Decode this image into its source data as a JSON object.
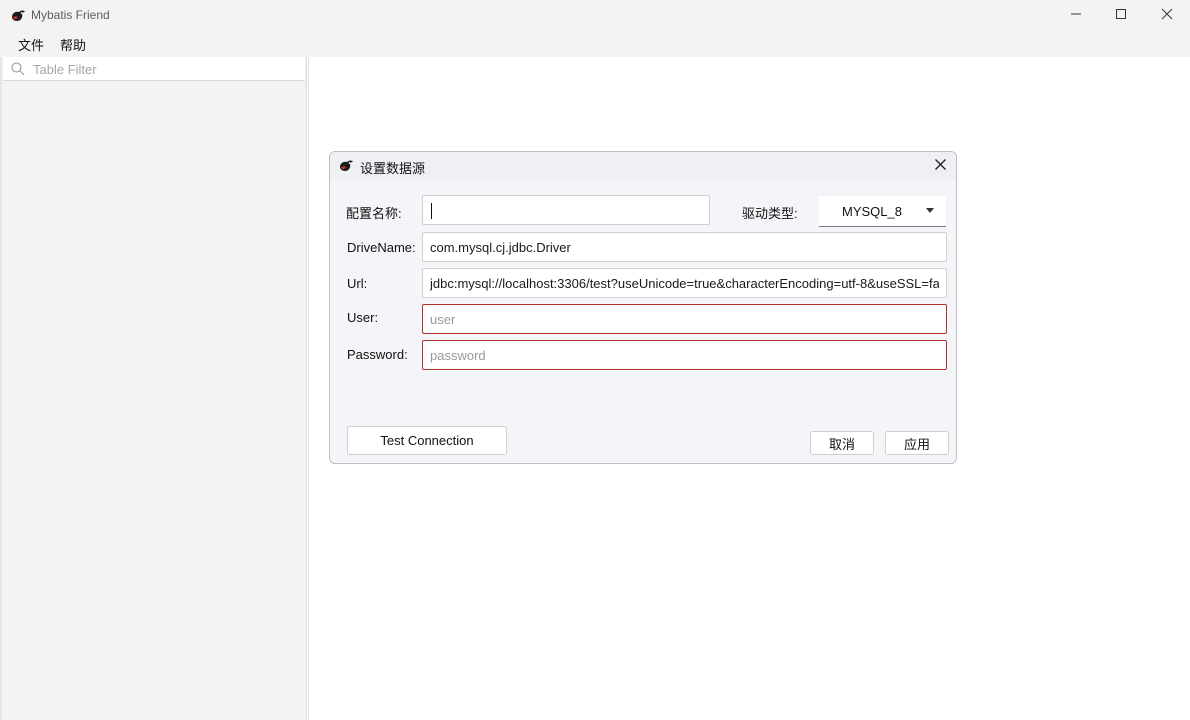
{
  "window": {
    "title": "Mybatis Friend"
  },
  "menu": {
    "items": [
      {
        "label": "文件"
      },
      {
        "label": "帮助"
      }
    ]
  },
  "sidebar": {
    "filter_placeholder": "Table Filter"
  },
  "dialog": {
    "title": "设置数据源",
    "config_name_label": "配置名称:",
    "config_name_value": "",
    "driver_type_label": "驱动类型:",
    "driver_type_value": "MYSQL_8",
    "drive_name_label": "DriveName:",
    "drive_name_value": "com.mysql.cj.jdbc.Driver",
    "url_label": "Url:",
    "url_value": "jdbc:mysql://localhost:3306/test?useUnicode=true&characterEncoding=utf-8&useSSL=fa",
    "user_label": "User:",
    "user_placeholder": "user",
    "password_label": "Password:",
    "password_placeholder": "password",
    "test_connection_label": "Test Connection",
    "cancel_label": "取消",
    "apply_label": "应用"
  },
  "colors": {
    "chrome_bg": "#f3f3f3",
    "dialog_bg": "#f4f5f8",
    "error_border": "#b52f2f",
    "accent": "#1a1a1a"
  },
  "icons": {
    "app": "mybatis-bird-icon",
    "search": "search-icon",
    "minimize": "minimize-icon",
    "maximize": "maximize-icon",
    "close": "close-icon",
    "dropdown": "caret-down-icon"
  }
}
